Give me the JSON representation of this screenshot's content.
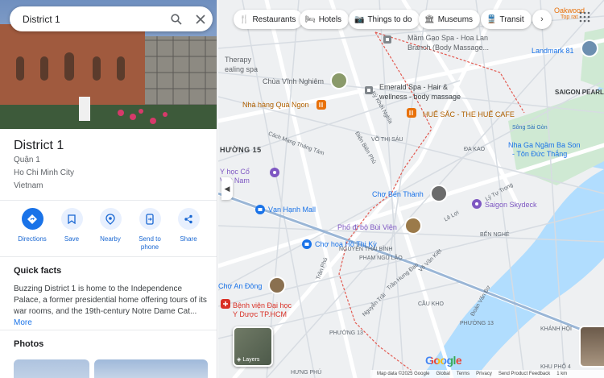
{
  "search": {
    "query": "District 1"
  },
  "place": {
    "title": "District 1",
    "local_name": "Quận 1",
    "city": "Ho Chi Minh City",
    "country": "Vietnam"
  },
  "actions": [
    {
      "label": "Directions",
      "icon": "directions-icon"
    },
    {
      "label": "Save",
      "icon": "bookmark-icon"
    },
    {
      "label": "Nearby",
      "icon": "nearby-icon"
    },
    {
      "label": "Send to phone",
      "label_line1": "Send to",
      "label_line2": "phone",
      "icon": "send-to-phone-icon"
    },
    {
      "label": "Share",
      "icon": "share-icon"
    }
  ],
  "quick_facts": {
    "title": "Quick facts",
    "text": "Buzzing District 1 is home to the Independence Palace, a former presidential home offering tours of its war rooms, and the 19th-century Notre Dame Cat...",
    "more": "More"
  },
  "photos": {
    "title": "Photos"
  },
  "chips": [
    {
      "label": "Restaurants",
      "icon": "restaurant-icon"
    },
    {
      "label": "Hotels",
      "icon": "hotel-icon"
    },
    {
      "label": "Things to do",
      "icon": "camera-icon"
    },
    {
      "label": "Museums",
      "icon": "museum-icon"
    },
    {
      "label": "Transit",
      "icon": "transit-icon"
    }
  ],
  "map_labels": {
    "mam_gao_1": "Mầm Gạo Spa - Hoa Lan",
    "mam_gao_2": "Branch (Body Massage...",
    "oakwood_1": "Oakwood",
    "oakwood_2": "Top rat",
    "landmark": "Landmark 81",
    "therapy_1": "Therapy",
    "therapy_2": "ealing spa",
    "chua_vinh_nghiem": "Chùa Vĩnh Nghiêm",
    "emerald_1": "Emerald Spa - Hair &",
    "emerald_2": "wellness - body massage",
    "nha_hang": "Nhà hàng Quá Ngon",
    "hue_sac": "HUẾ SẮC - THE HUẾ CAFE",
    "saigon_pearl": "SAIGON PEARL",
    "vo_thi_sau": "VÕ THỊ SÁU",
    "da_kao": "ĐA KAO",
    "phuong_15": "HƯỜNG 15",
    "cach_mang": "Cách Mạng Tháng Tám",
    "dien_bien_phu": "Điện Biên Phủ",
    "nha_ga_1": "Nha Ga Ngầm Ba Son",
    "nha_ga_2": "- Tôn Đức Thắng",
    "y_hoc_1": "Y học Cổ",
    "y_hoc_2": "Việt Nam",
    "cho_ben_thanh": "Chợ Bến Thành",
    "saigon_skydeck": "Saigon Skydeck",
    "van_hanh_mall": "Vạn Hạnh Mall",
    "pho_di_bo": "Phố đi bộ Bùi Viện",
    "ben_nghe": "BẾN NGHÉ",
    "cho_ho_thi_ky": "Chợ hoa Hồ Thị Kỳ",
    "nguyen_thai_binh": "NGUYỄN THÁI BÌNH",
    "pham_ngu_lao": "PHẠM NGŨ LÃO",
    "tran_hung_dao": "Trần Hưng Đạo",
    "vo_van_kiet": "Võ Văn Kiệt",
    "cho_an_dong": "Chợ An Đông",
    "benh_vien_1": "Bệnh viện Đại học",
    "benh_vien_2": "Y Dược TP.HCM",
    "cau_kho": "CẦU KHO",
    "phuong_13": "PHƯỜNG 13",
    "ward_13": "PHƯỜNG 13",
    "khanh_hoi": "KHÁNH HỘI",
    "khu_pho_4": "KHU PHỐ 4",
    "hung_phu": "HƯNG PHÚ",
    "song_sai_gon": "Sông Sài Gòn",
    "ky_khoi_nghia": "Kỳ Khởi Nghĩa",
    "tran_phu": "Trần Phú",
    "nguyen_trai": "Nguyễn Trãi",
    "doan_van_bo": "Đoàn Văn Bơ",
    "ly_tu_trong": "Lý Tự Trọng",
    "le_loi": "Lê Lợi"
  },
  "map_controls": {
    "layers": "Layers",
    "google": "Google",
    "map_data": "Map data ©2025 Google",
    "global": "Global",
    "terms": "Terms",
    "privacy": "Privacy",
    "feedback": "Send Product Feedback",
    "scale": "1 km"
  }
}
